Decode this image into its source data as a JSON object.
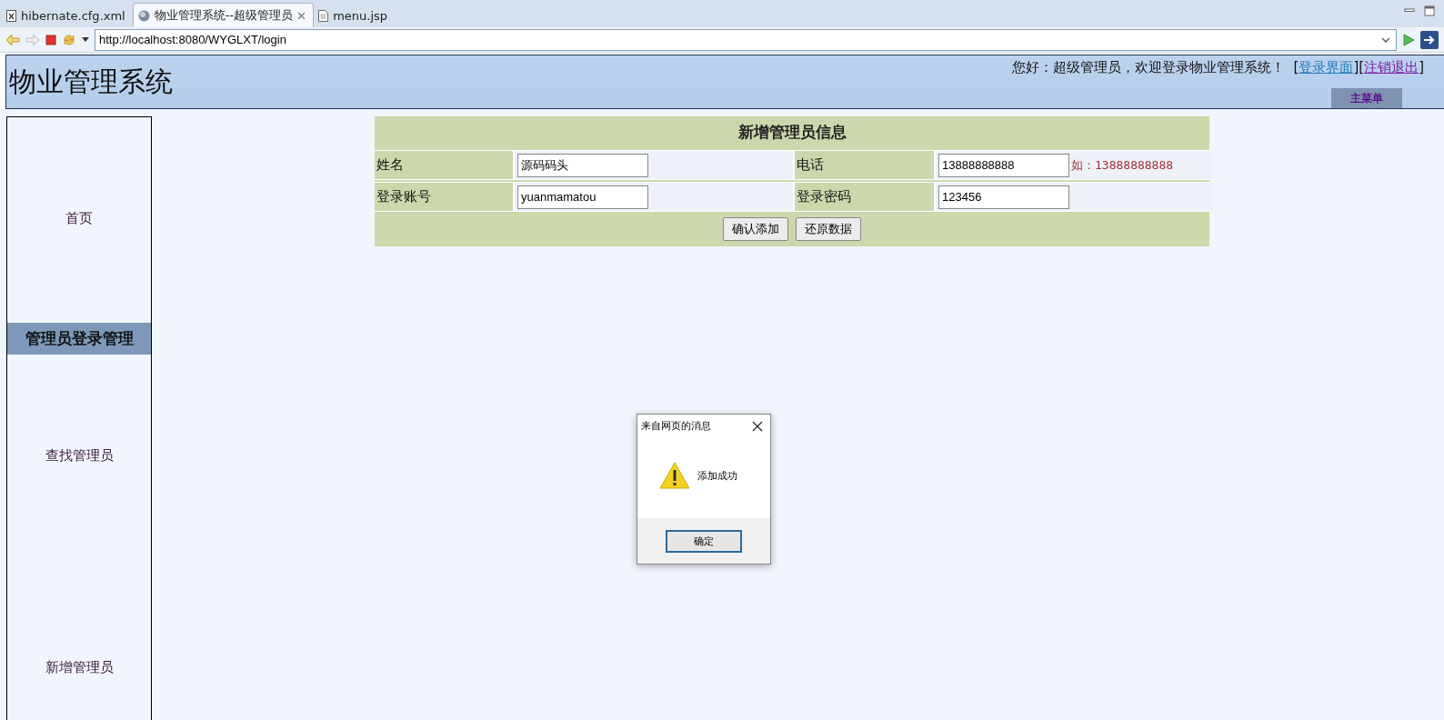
{
  "tabs": [
    {
      "label": "hibernate.cfg.xml",
      "kind": "xml",
      "selected": false
    },
    {
      "label": "物业管理系统--超级管理员",
      "kind": "web",
      "selected": true
    },
    {
      "label": "menu.jsp",
      "kind": "jsp",
      "selected": false
    }
  ],
  "address_bar": {
    "value": "http://localhost:8080/WYGLXT/login"
  },
  "header": {
    "title": "物业管理系统",
    "greeting": "您好：超级管理员，欢迎登录物业管理系统！",
    "links": [
      {
        "open": "[",
        "label": "登录界面",
        "close": "]",
        "visited": false
      },
      {
        "open": "[",
        "label": "注销退出",
        "close": "]",
        "visited": true
      }
    ],
    "menu_button": "主菜单"
  },
  "sidebar": {
    "items": [
      {
        "kind": "link",
        "label": "首页"
      },
      {
        "kind": "section",
        "label": "管理员登录管理"
      },
      {
        "kind": "link",
        "label": "查找管理员"
      },
      {
        "kind": "link",
        "label": "新增管理员"
      }
    ]
  },
  "form": {
    "title": "新增管理员信息",
    "rows": [
      {
        "fields": [
          {
            "label": "姓名",
            "value": "源码码头"
          },
          {
            "label": "电话",
            "value": "13888888888",
            "hint": "如：13888888888"
          }
        ]
      },
      {
        "fields": [
          {
            "label": "登录账号",
            "value": "yuanmamatou"
          },
          {
            "label": "登录密码",
            "value": "123456"
          }
        ]
      }
    ],
    "buttons": [
      "确认添加",
      "还原数据"
    ]
  },
  "dialog": {
    "title": "来自网页的消息",
    "message": "添加成功",
    "button": "确定"
  }
}
